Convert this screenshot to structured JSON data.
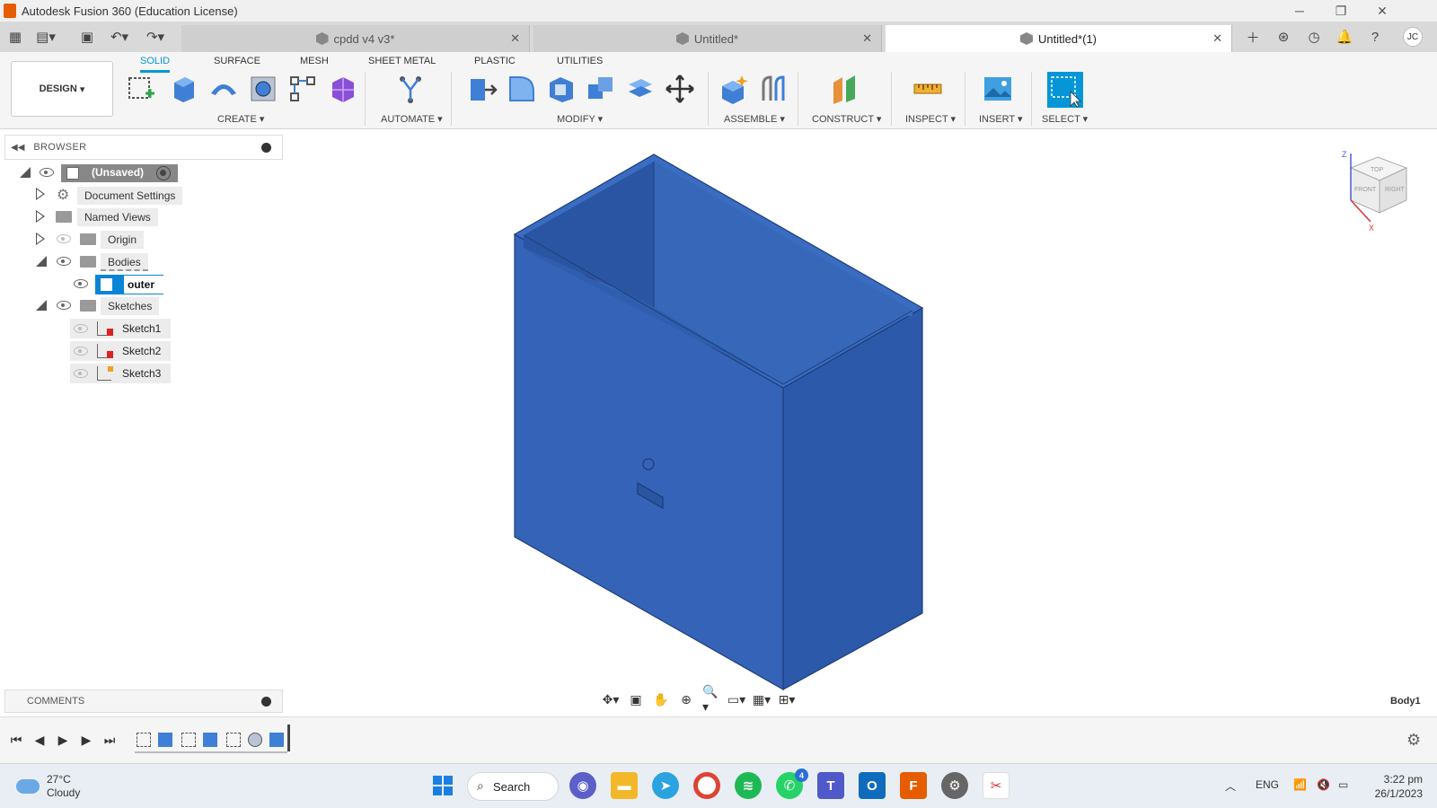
{
  "window": {
    "title": "Autodesk Fusion 360 (Education License)",
    "minimize": "─",
    "restore": "❐",
    "close": "✕"
  },
  "doc_tabs": [
    {
      "label": "cpdd v4 v3*",
      "active": false
    },
    {
      "label": "Untitled*",
      "active": false
    },
    {
      "label": "Untitled*(1)",
      "active": true
    }
  ],
  "header_icons": {
    "avatar_initials": "JC"
  },
  "ribbon": {
    "workspace": "DESIGN",
    "tabs": [
      "SOLID",
      "SURFACE",
      "MESH",
      "SHEET METAL",
      "PLASTIC",
      "UTILITIES"
    ],
    "groups": [
      "CREATE",
      "AUTOMATE",
      "MODIFY",
      "ASSEMBLE",
      "CONSTRUCT",
      "INSPECT",
      "INSERT",
      "SELECT"
    ]
  },
  "browser": {
    "title": "BROWSER",
    "root": "(Unsaved)",
    "nodes": {
      "document_settings": "Document Settings",
      "named_views": "Named Views",
      "origin": "Origin",
      "bodies": "Bodies",
      "outer_box": "outer box",
      "sketches": "Sketches",
      "sketch1": "Sketch1",
      "sketch2": "Sketch2",
      "sketch3": "Sketch3"
    }
  },
  "viewcube": {
    "top": "TOP",
    "front": "FRONT",
    "right": "RIGHT",
    "z": "Z",
    "x": "X"
  },
  "viewport": {
    "body_label": "Body1",
    "model_color": "#2f5fb3"
  },
  "comments": {
    "title": "COMMENTS"
  },
  "taskbar": {
    "weather_temp": "27°C",
    "weather_desc": "Cloudy",
    "search": "Search",
    "language": "ENG",
    "time": "3:22 pm",
    "date": "26/1/2023",
    "badges": {
      "whatsapp": "4"
    }
  },
  "colors": {
    "accent": "#0696d7",
    "fusion_orange": "#e65c00"
  }
}
